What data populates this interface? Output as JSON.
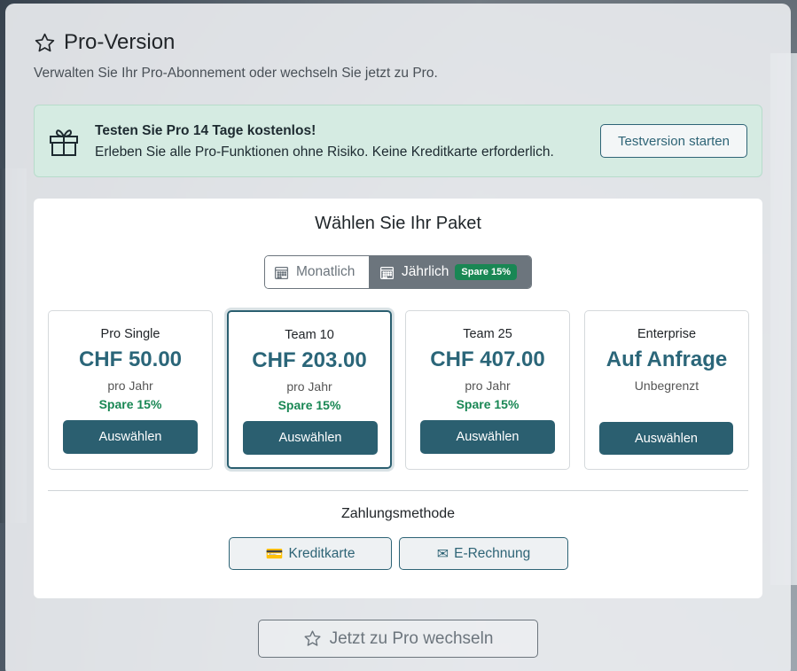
{
  "page": {
    "title": "Pro-Version",
    "subtitle": "Verwalten Sie Ihr Pro-Abonnement oder wechseln Sie jetzt zu Pro."
  },
  "trial": {
    "heading": "Testen Sie Pro 14 Tage kostenlos!",
    "text": "Erleben Sie alle Pro-Funktionen ohne Risiko. Keine Kreditkarte erforderlich.",
    "button": "Testversion starten"
  },
  "packages": {
    "heading": "Wählen Sie Ihr Paket",
    "billing": {
      "monthly": "Monatlich",
      "yearly": "Jährlich",
      "yearly_badge": "Spare 15%",
      "selected": "yearly"
    },
    "plans": [
      {
        "name": "Pro Single",
        "price": "CHF 50.00",
        "period": "pro Jahr",
        "saving": "Spare 15%",
        "button": "Auswählen"
      },
      {
        "name": "Team 10",
        "price": "CHF 203.00",
        "period": "pro Jahr",
        "saving": "Spare 15%",
        "button": "Auswählen"
      },
      {
        "name": "Team 25",
        "price": "CHF 407.00",
        "period": "pro Jahr",
        "saving": "Spare 15%",
        "button": "Auswählen"
      },
      {
        "name": "Enterprise",
        "price": "Auf Anfrage",
        "period": "Unbegrenzt",
        "button": "Auswählen"
      }
    ],
    "selected_plan": "Team 10"
  },
  "payment": {
    "label": "Zahlungsmethode",
    "methods": [
      {
        "icon": "credit-card-icon",
        "glyph": "💳",
        "label": "Kreditkarte"
      },
      {
        "icon": "envelope-icon",
        "glyph": "✉",
        "label": "E-Rechnung"
      }
    ]
  },
  "cta": {
    "label": "Jetzt zu Pro wechseln"
  },
  "colors": {
    "accent": "#2b5f70",
    "price": "#2b6679",
    "saving": "#198754",
    "trial_bg": "#d5ebe2"
  }
}
